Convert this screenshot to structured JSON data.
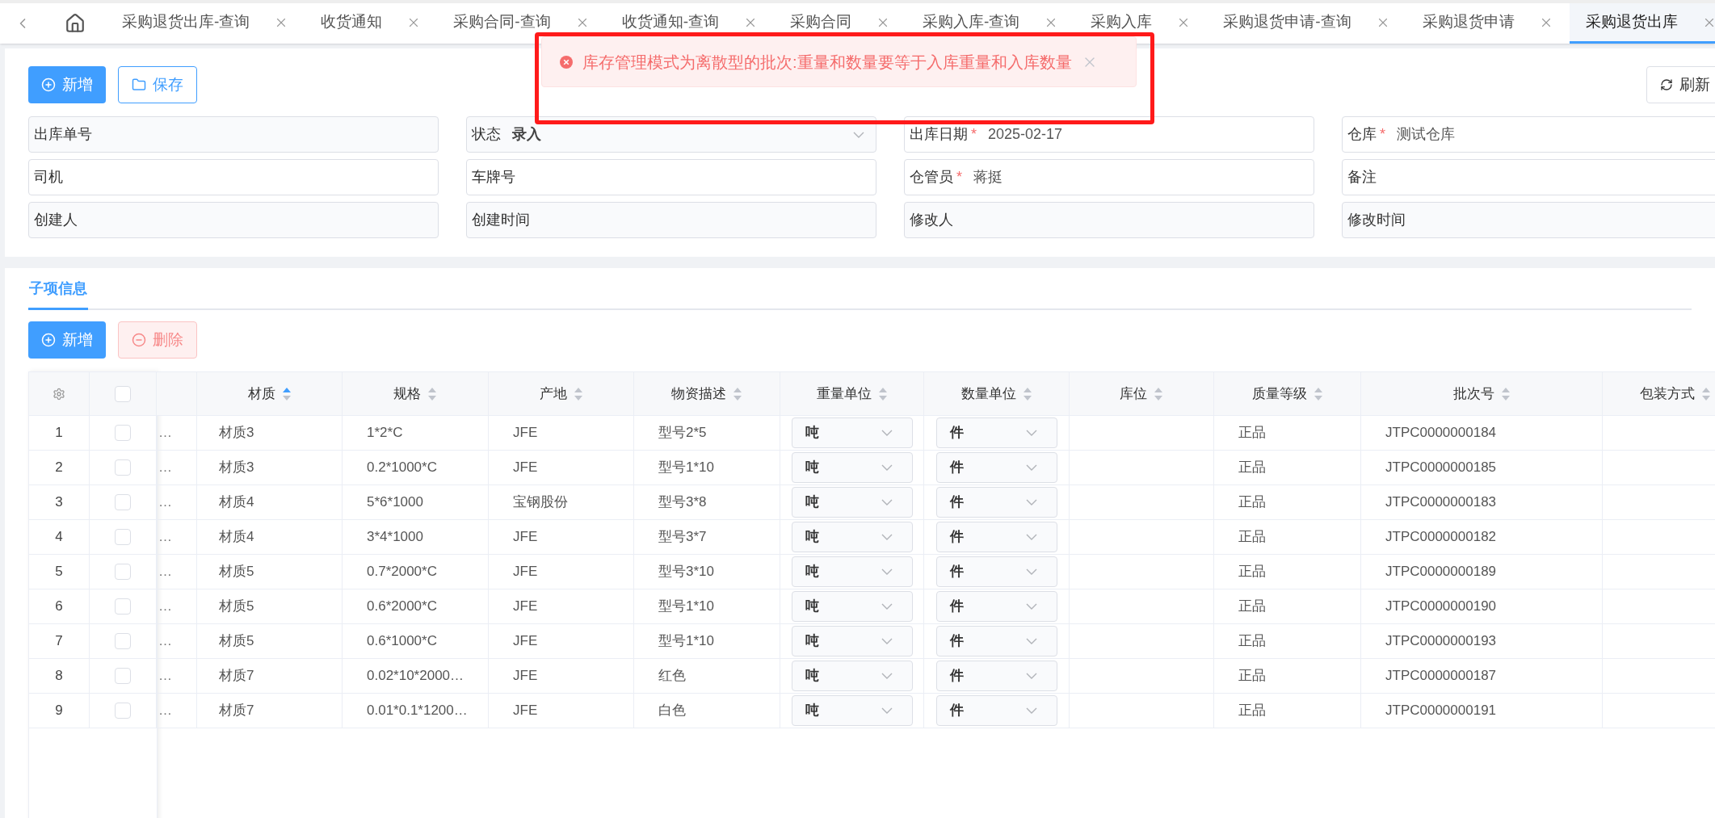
{
  "tabs": [
    {
      "label": "采购退货出库-查询",
      "selected": false
    },
    {
      "label": "收货通知",
      "selected": false
    },
    {
      "label": "采购合同-查询",
      "selected": false
    },
    {
      "label": "收货通知-查询",
      "selected": false
    },
    {
      "label": "采购合同",
      "selected": false
    },
    {
      "label": "采购入库-查询",
      "selected": false
    },
    {
      "label": "采购入库",
      "selected": false
    },
    {
      "label": "采购退货申请-查询",
      "selected": false
    },
    {
      "label": "采购退货申请",
      "selected": false
    },
    {
      "label": "采购退货出库",
      "selected": true
    }
  ],
  "toolbar": {
    "add": "新增",
    "save": "保存",
    "refresh": "刷新"
  },
  "error_message": "库存管理模式为离散型的批次:重量和数量要等于入库重量和入库数量",
  "form_fields": [
    {
      "label": "出库单号",
      "kind": "readonly"
    },
    {
      "label": "状态",
      "value": "录入",
      "kind": "select"
    },
    {
      "label": "出库日期",
      "required_mark": "*",
      "value": "2025-02-17",
      "kind": "input"
    },
    {
      "label": "仓库",
      "required_mark": "*",
      "value": "测试仓库",
      "kind": "input"
    },
    {
      "label": "司机",
      "kind": "input"
    },
    {
      "label": "车牌号",
      "kind": "input"
    },
    {
      "label": "仓管员",
      "required_mark": "*",
      "value": "蒋挺",
      "kind": "input"
    },
    {
      "label": "备注",
      "kind": "input"
    },
    {
      "label": "创建人",
      "kind": "readonly"
    },
    {
      "label": "创建时间",
      "kind": "readonly"
    },
    {
      "label": "修改人",
      "kind": "readonly"
    },
    {
      "label": "修改时间",
      "kind": "readonly"
    }
  ],
  "section_tab": "子项信息",
  "detail_toolbar": {
    "add": "新增",
    "delete": "删除"
  },
  "table": {
    "select_all_checked": false,
    "columns": [
      {
        "label": "材质",
        "sorted": true
      },
      {
        "label": "规格",
        "sorted": false
      },
      {
        "label": "产地",
        "sorted": false
      },
      {
        "label": "物资描述",
        "sorted": false
      },
      {
        "label": "重量单位",
        "sorted": false
      },
      {
        "label": "数量单位",
        "sorted": false
      },
      {
        "label": "库位",
        "sorted": false
      },
      {
        "label": "质量等级",
        "sorted": false
      },
      {
        "label": "批次号",
        "sorted": false
      },
      {
        "label": "包装方式",
        "sorted": false
      }
    ],
    "rows": [
      {
        "no": "1",
        "checked": false,
        "column_1": "…",
        "material": "材质3",
        "spec": "1*2*C",
        "origin": "JFE",
        "description": "型号2*5",
        "weight_unit": "吨",
        "qty_unit": "件",
        "grade": "正品",
        "batch": "JTPC0000000184"
      },
      {
        "no": "2",
        "checked": false,
        "column_1": "…",
        "material": "材质3",
        "spec": "0.2*1000*C",
        "origin": "JFE",
        "description": "型号1*10",
        "weight_unit": "吨",
        "qty_unit": "件",
        "grade": "正品",
        "batch": "JTPC0000000185"
      },
      {
        "no": "3",
        "checked": false,
        "column_1": "…",
        "material": "材质4",
        "spec": "5*6*1000",
        "origin": "宝钢股份",
        "description": "型号3*8",
        "weight_unit": "吨",
        "qty_unit": "件",
        "grade": "正品",
        "batch": "JTPC0000000183"
      },
      {
        "no": "4",
        "checked": false,
        "column_1": "…",
        "material": "材质4",
        "spec": "3*4*1000",
        "origin": "JFE",
        "description": "型号3*7",
        "weight_unit": "吨",
        "qty_unit": "件",
        "grade": "正品",
        "batch": "JTPC0000000182"
      },
      {
        "no": "5",
        "checked": false,
        "column_1": "…",
        "material": "材质5",
        "spec": "0.7*2000*C",
        "origin": "JFE",
        "description": "型号3*10",
        "weight_unit": "吨",
        "qty_unit": "件",
        "grade": "正品",
        "batch": "JTPC0000000189"
      },
      {
        "no": "6",
        "checked": false,
        "column_1": "…",
        "material": "材质5",
        "spec": "0.6*2000*C",
        "origin": "JFE",
        "description": "型号1*10",
        "weight_unit": "吨",
        "qty_unit": "件",
        "grade": "正品",
        "batch": "JTPC0000000190"
      },
      {
        "no": "7",
        "checked": false,
        "column_1": "…",
        "material": "材质5",
        "spec": "0.6*1000*C",
        "origin": "JFE",
        "description": "型号1*10",
        "weight_unit": "吨",
        "qty_unit": "件",
        "grade": "正品",
        "batch": "JTPC0000000193"
      },
      {
        "no": "8",
        "checked": false,
        "column_1": "…",
        "material": "材质7",
        "spec": "0.02*10*2000…",
        "origin": "JFE",
        "description": "红色",
        "weight_unit": "吨",
        "qty_unit": "件",
        "grade": "正品",
        "batch": "JTPC0000000187"
      },
      {
        "no": "9",
        "checked": false,
        "column_1": "…",
        "material": "材质7",
        "spec": "0.01*0.1*1200…",
        "origin": "JFE",
        "description": "白色",
        "weight_unit": "吨",
        "qty_unit": "件",
        "grade": "正品",
        "batch": "JTPC0000000191"
      }
    ]
  }
}
